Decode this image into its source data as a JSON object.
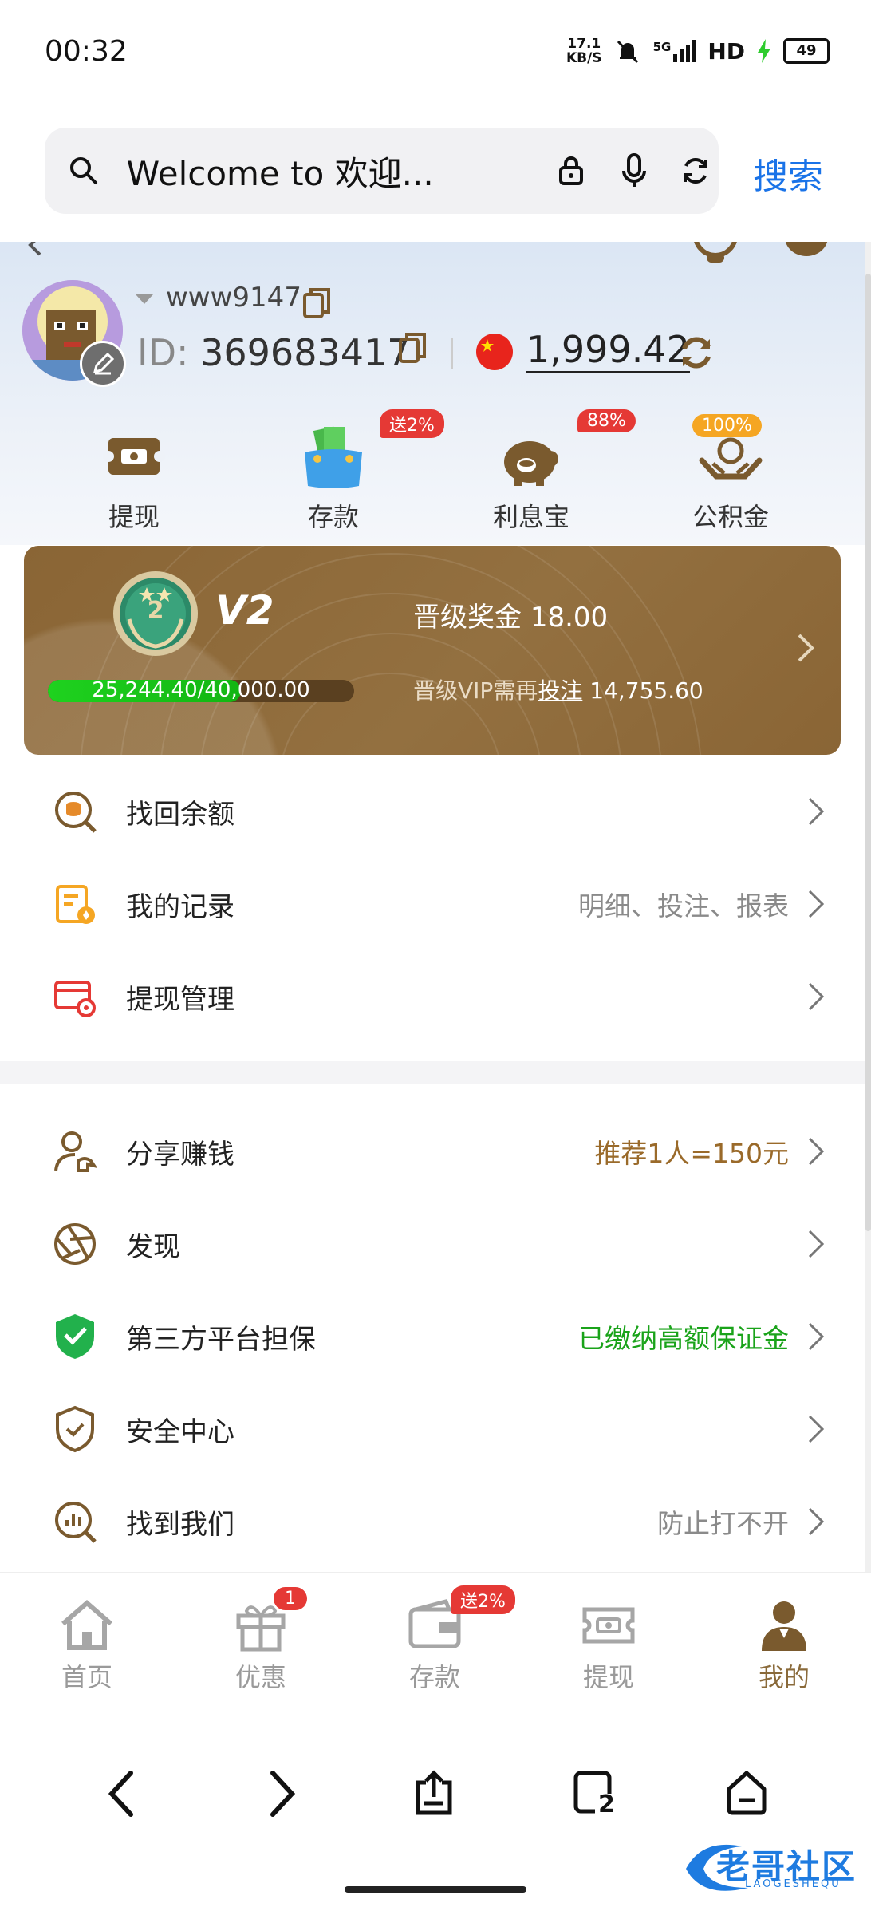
{
  "status_bar": {
    "time": "00:32",
    "net_speed_value": "17.1",
    "net_speed_unit": "KB/S",
    "net_type": "5G",
    "hd": "HD",
    "battery": "49"
  },
  "browser": {
    "search_text": "Welcome to 欢迎...",
    "search_button": "搜索"
  },
  "profile": {
    "username": "www9147",
    "id_label": "ID:",
    "id_value": "369683417",
    "balance": "1,999.42"
  },
  "quick_actions": [
    {
      "label": "提现",
      "badge": ""
    },
    {
      "label": "存款",
      "badge": "送2%"
    },
    {
      "label": "利息宝",
      "badge": "88%"
    },
    {
      "label": "公积金",
      "badge": "100%"
    }
  ],
  "vip": {
    "medal_number": "2",
    "level": "V2",
    "bonus_label": "晋级奖金",
    "bonus_value": "18.00",
    "progress_text": "25,244.40/40,000.00",
    "progress_fraction": 0.6311,
    "need_prefix": "晋级VIP需再",
    "need_link": "投注",
    "need_value": "14,755.60"
  },
  "menu_group_1": [
    {
      "label": "找回余额",
      "hint": ""
    },
    {
      "label": "我的记录",
      "hint": "明细、投注、报表"
    },
    {
      "label": "提现管理",
      "hint": ""
    }
  ],
  "menu_group_2": [
    {
      "label": "分享赚钱",
      "hint": "推荐1人=150元"
    },
    {
      "label": "发现",
      "hint": ""
    },
    {
      "label": "第三方平台担保",
      "hint": "已缴纳高额保证金"
    },
    {
      "label": "安全中心",
      "hint": ""
    },
    {
      "label": "找到我们",
      "hint": "防止打不开"
    }
  ],
  "tabs": [
    {
      "label": "首页",
      "badge": ""
    },
    {
      "label": "优惠",
      "badge": "1"
    },
    {
      "label": "存款",
      "badge": "送2%"
    },
    {
      "label": "提现",
      "badge": ""
    },
    {
      "label": "我的",
      "badge": ""
    }
  ],
  "nav": {
    "tab_count": "2"
  },
  "watermark": {
    "text": "老哥社区",
    "sub": "LAOGESHEQU"
  },
  "colors": {
    "brand_brown": "#8a6a3a",
    "link_blue": "#1a73e8",
    "green": "#1aa31a",
    "gold_hint": "#9a6a2a"
  }
}
